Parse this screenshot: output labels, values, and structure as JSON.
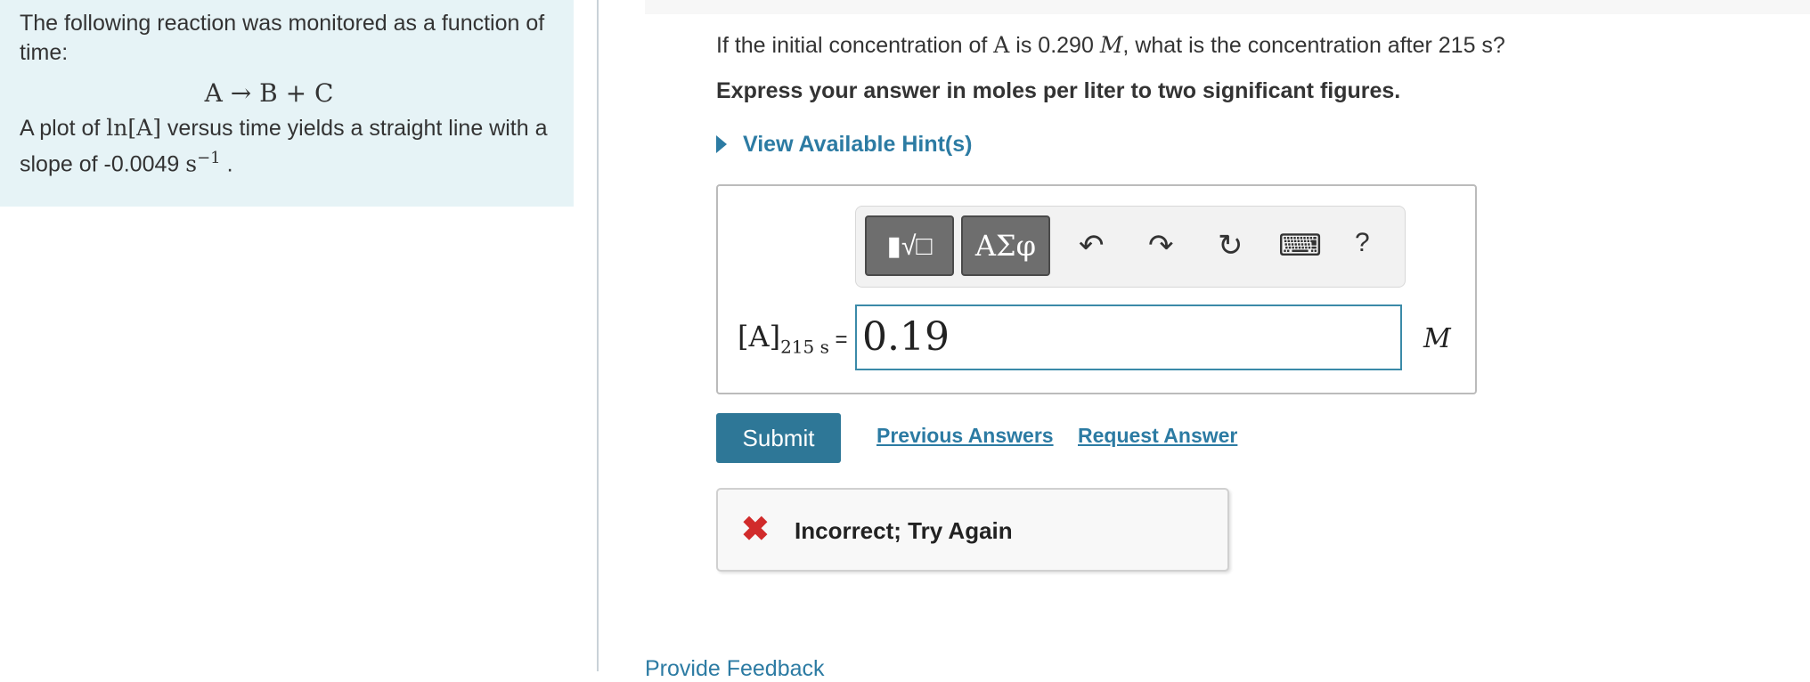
{
  "problem": {
    "intro": "The following reaction was monitored as a function of time:",
    "equation": "A → B + C",
    "plot_text_before": "A plot of ",
    "plot_ln": "ln[A]",
    "plot_text_after": " versus time yields a straight line with a slope of -0.0049 ",
    "slope_unit": "s",
    "slope_exp": "−1",
    "period": " ."
  },
  "question": {
    "prefix": "If the initial concentration of ",
    "species": "A",
    "middle": " is 0.290 ",
    "unit_symbol": "M",
    "suffix": ", what is the concentration after 215 s?"
  },
  "instruction": "Express your answer in moles per liter to two significant figures.",
  "hints_label": "View Available Hint(s)",
  "toolbar": {
    "templates_icon": "▮√□",
    "greek_label": "ΑΣφ",
    "undo_icon": "↶",
    "redo_icon": "↷",
    "reset_icon": "↻",
    "keyboard_icon": "⌨",
    "help_icon": "?"
  },
  "answer": {
    "label_main": "[A]",
    "label_sub": "215 s",
    "label_equals": " =",
    "value": "0.19",
    "unit": "M"
  },
  "actions": {
    "submit_label": "Submit",
    "previous_answers": "Previous Answers",
    "request_answer": "Request Answer"
  },
  "feedback": {
    "icon": "✖",
    "text": "Incorrect; Try Again"
  },
  "provide_feedback": "Provide Feedback",
  "colors": {
    "accent": "#2c7ba3",
    "submit_bg": "#2e7797",
    "error": "#d12b2b",
    "panel_bg": "#e6f3f6"
  }
}
